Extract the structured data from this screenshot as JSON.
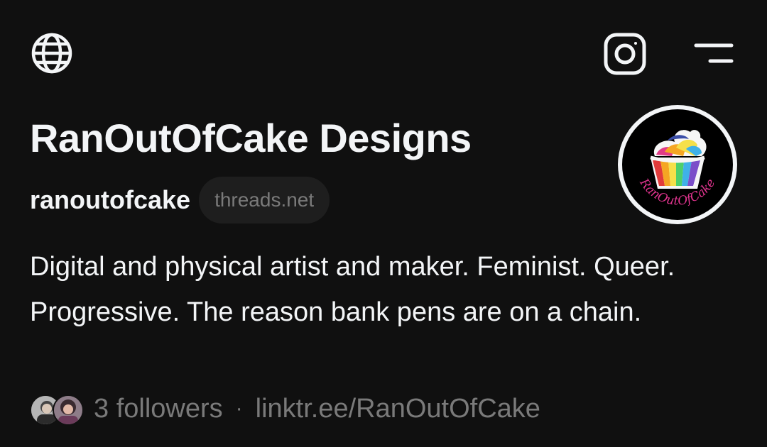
{
  "header": {
    "icons": {
      "globe": "globe-icon",
      "instagram": "instagram-icon",
      "menu": "menu-icon"
    }
  },
  "profile": {
    "display_name": "RanOutOfCake Designs",
    "username": "ranoutofcake",
    "domain_badge": "threads.net",
    "avatar_text": "RanOutOfCake",
    "bio": "Digital and physical artist and maker. Feminist. Queer. Progressive. The reason bank pens are on a chain.",
    "followers_label": "3 followers",
    "separator": "·",
    "link": "linktr.ee/RanOutOfCake"
  },
  "colors": {
    "background": "#101010",
    "primary_text": "#f3f5f7",
    "secondary_text": "#7a7a7a",
    "pill_background": "#1e1e1e",
    "avatar_text_pink": "#e2348f"
  }
}
